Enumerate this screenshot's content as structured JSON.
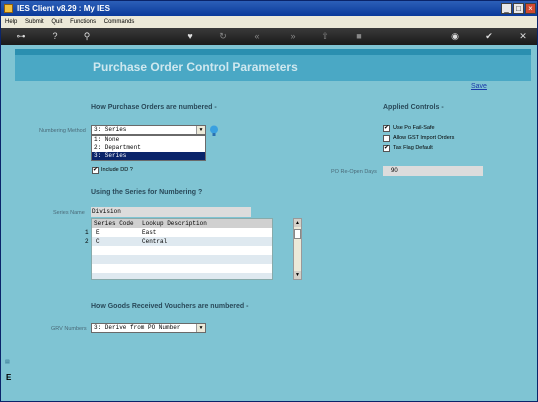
{
  "window": {
    "title": "IES Client v8.29 : My IES"
  },
  "menu": [
    "Help",
    "Submit",
    "Quit",
    "Functions",
    "Commands"
  ],
  "page": {
    "title": "Purchase Order Control Parameters",
    "save_label": "Save"
  },
  "numbering": {
    "section_title": "How Purchase Orders are numbered -",
    "method_label": "Numbering Method",
    "method_value": "3: Series",
    "options": [
      "1: None",
      "2: Department",
      "3: Series"
    ],
    "include_dd_label": "Include DD ?",
    "include_dd_checked": true
  },
  "applied_controls": {
    "section_title": "Applied Controls -",
    "items": [
      {
        "label": "Use Po Fail-Safe",
        "checked": true
      },
      {
        "label": "Allow GST Import Orders",
        "checked": false
      },
      {
        "label": "Tax Flag Default",
        "checked": true
      }
    ],
    "po_reopen_label": "PO Re-Open Days",
    "po_reopen_value": "90"
  },
  "series": {
    "section_title": "Using the Series for Numbering ?",
    "name_label": "Series Name",
    "name_value": "Division",
    "columns": [
      "Series Code",
      "Lookup Description"
    ],
    "rows": [
      {
        "num": "1",
        "code": "E",
        "description": "East"
      },
      {
        "num": "2",
        "code": "C",
        "description": "Central"
      }
    ]
  },
  "grv": {
    "section_title": "How Goods Received Vouchers are numbered -",
    "label": "GRV Numbers",
    "value": "3: Derive from PO Number"
  },
  "colors": {
    "header_bg": "#4aa8c5",
    "body_bg": "#7fc4d3",
    "title_text": "#cfe8ef"
  }
}
